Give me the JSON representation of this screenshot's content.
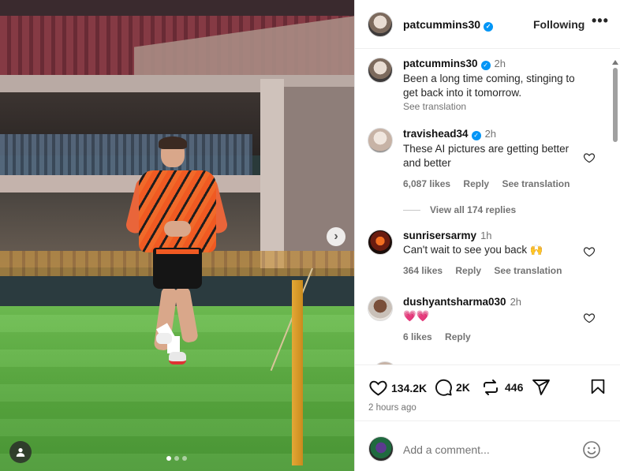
{
  "post": {
    "author": "patcummins30",
    "follow_label": "Following",
    "more_label": "•••",
    "caption_author": "patcummins30",
    "caption_time": "2h",
    "caption_text": "Been a long time coming, stinging to get back into it tomorrow.",
    "see_translation": "See translation",
    "carousel": {
      "current": 1,
      "total": 3
    }
  },
  "comments": [
    {
      "user": "travishead34",
      "verified": true,
      "time": "2h",
      "text": "These AI pictures are getting better and better",
      "likes": "6,087 likes",
      "reply": "Reply",
      "translate": "See translation",
      "view_replies": "View all 174 replies"
    },
    {
      "user": "sunrisersarmy",
      "time": "1h",
      "text": "Can't wait to see you back 🙌",
      "likes": "364 likes",
      "reply": "Reply",
      "translate": "See translation"
    },
    {
      "user": "dushyantsharma030",
      "time": "2h",
      "text": "💗💗",
      "likes": "6 likes",
      "reply": "Reply"
    }
  ],
  "stats": {
    "likes": "134.2K",
    "comments": "2K",
    "reposts": "446",
    "posted_ago": "2 hours ago"
  },
  "composer": {
    "placeholder": "Add a comment..."
  },
  "colors": {
    "verified": "#0095f6",
    "secondary_text": "#737373",
    "primary_text": "#262626"
  },
  "icons": [
    "verified-badge-icon",
    "heart-icon",
    "comment-icon",
    "repost-icon",
    "share-icon",
    "bookmark-icon",
    "emoji-icon",
    "chevron-right-icon",
    "user-tag-icon"
  ]
}
